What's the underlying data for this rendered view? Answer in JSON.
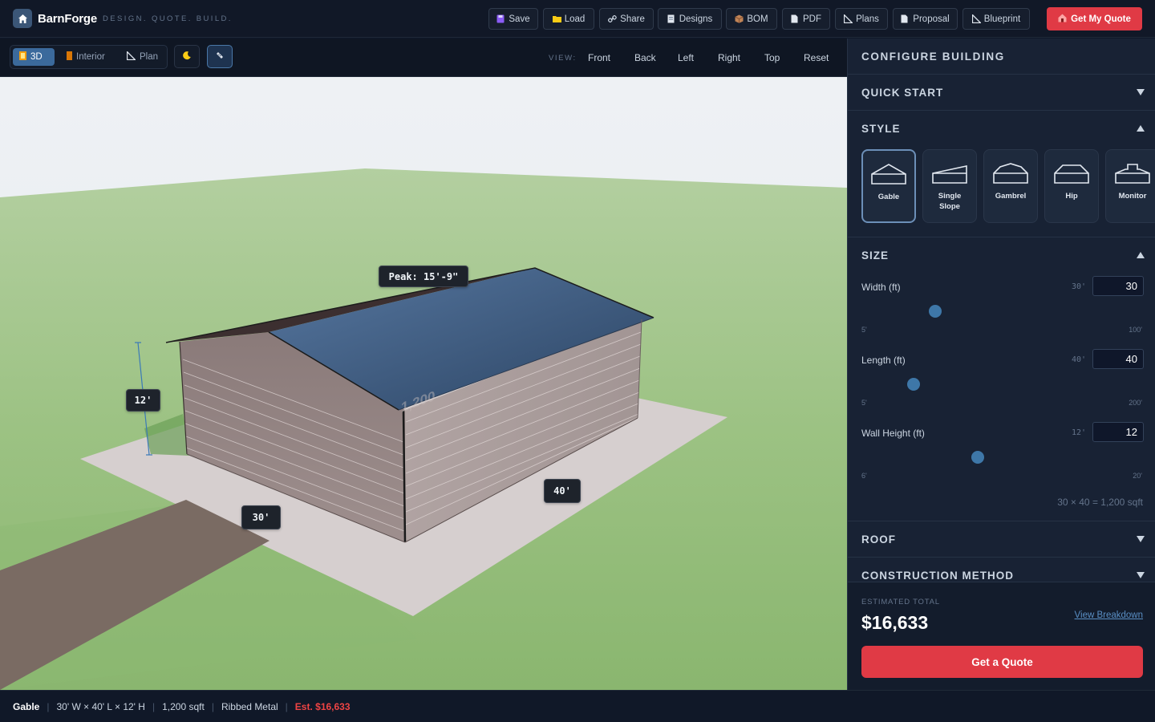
{
  "app": {
    "name": "BarnForge",
    "tagline": "DESIGN. QUOTE. BUILD."
  },
  "topbar": {
    "buttons": [
      {
        "label": "Save",
        "icon": "floppy-icon"
      },
      {
        "label": "Load",
        "icon": "folder-icon"
      },
      {
        "label": "Share",
        "icon": "link-icon"
      },
      {
        "label": "Designs",
        "icon": "document-icon"
      },
      {
        "label": "BOM",
        "icon": "box-icon"
      },
      {
        "label": "PDF",
        "icon": "file-icon"
      },
      {
        "label": "Plans",
        "icon": "triangle-ruler-icon"
      },
      {
        "label": "Proposal",
        "icon": "file-icon"
      },
      {
        "label": "Blueprint",
        "icon": "triangle-ruler-icon"
      }
    ],
    "cta_label": "Get My Quote"
  },
  "toolbar": {
    "modes": [
      {
        "label": "3D",
        "active": true
      },
      {
        "label": "Interior",
        "active": false
      },
      {
        "label": "Plan",
        "active": false
      }
    ],
    "view_label": "VIEW:",
    "views": [
      "Front",
      "Back",
      "Left",
      "Right",
      "Top",
      "Reset"
    ]
  },
  "viewport": {
    "peak_label": "Peak: 15'-9\"",
    "height_label": "12'",
    "width_label": "30'",
    "length_label": "40'"
  },
  "panel": {
    "title": "CONFIGURE BUILDING",
    "sections": {
      "quick_start": "QUICK START",
      "style": "STYLE",
      "size": "SIZE",
      "roof": "ROOF",
      "construction": "CONSTRUCTION METHOD"
    },
    "styles": [
      {
        "label": "Gable",
        "active": true
      },
      {
        "label": "Single Slope",
        "active": false
      },
      {
        "label": "Gambrel",
        "active": false
      },
      {
        "label": "Hip",
        "active": false
      },
      {
        "label": "Monitor",
        "active": false
      }
    ],
    "size": {
      "rows": [
        {
          "label": "Width (ft)",
          "current": "30'",
          "value": "30",
          "min": "5'",
          "max": "100'",
          "level": 0.263
        },
        {
          "label": "Length (ft)",
          "current": "40'",
          "value": "40",
          "min": "5'",
          "max": "200'",
          "level": 0.179
        },
        {
          "label": "Wall Height (ft)",
          "current": "12'",
          "value": "12",
          "min": "6'",
          "max": "20'",
          "level": 0.429
        }
      ],
      "area_text": "30 × 40 = 1,200 sqft"
    },
    "estimate": {
      "label": "ESTIMATED TOTAL",
      "value": "$16,633",
      "link": "View Breakdown",
      "button": "Get a Quote"
    }
  },
  "status": {
    "style": "Gable",
    "dims": "30' W × 40' L × 12' H",
    "area": "1,200 sqft",
    "material": "Ribbed Metal",
    "estimate": "Est. $16,633"
  },
  "colors": {
    "accent": "#e03a45",
    "panel_bg": "#182234",
    "slider": "#3e77a8",
    "roof": "#3d5675",
    "wall": "#a39695",
    "grass": "#a3c58a"
  }
}
